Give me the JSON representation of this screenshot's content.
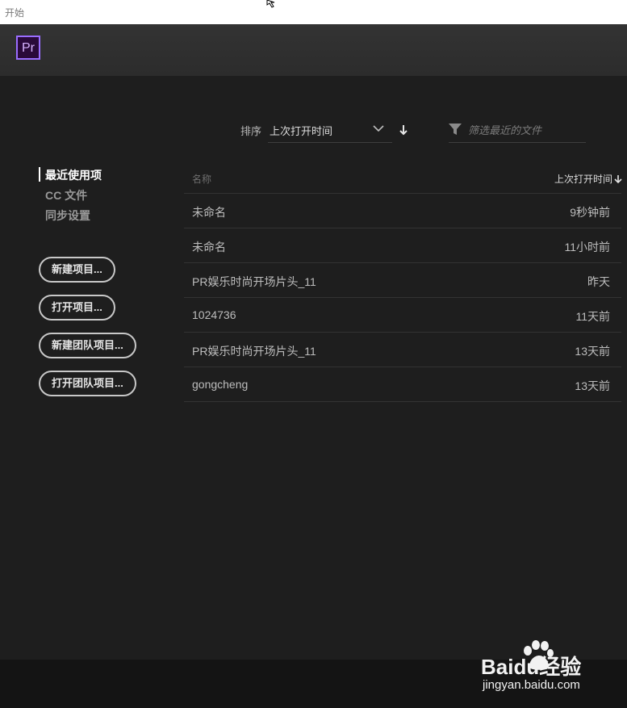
{
  "window": {
    "title": "开始"
  },
  "app": {
    "logo_text": "Pr",
    "accent": "#9a6dff"
  },
  "sort": {
    "label": "排序",
    "selected": "上次打开时间",
    "direction": "descending"
  },
  "filter": {
    "placeholder": "筛选最近的文件"
  },
  "nav": {
    "items": [
      {
        "label": "最近使用项",
        "active": true
      },
      {
        "label": "CC 文件",
        "active": false
      },
      {
        "label": "同步设置",
        "active": false
      }
    ]
  },
  "buttons": {
    "new_project": "新建项目...",
    "open_project": "打开项目...",
    "new_team_project": "新建团队项目...",
    "open_team_project": "打开团队项目..."
  },
  "table": {
    "col_name": "名称",
    "col_time": "上次打开时间",
    "rows": [
      {
        "name": "未命名",
        "time": "9秒钟前"
      },
      {
        "name": "未命名",
        "time": "11小时前"
      },
      {
        "name": "PR娱乐时尚开场片头_11",
        "time": "昨天"
      },
      {
        "name": "1024736",
        "time": "11天前"
      },
      {
        "name": "PR娱乐时尚开场片头_11",
        "time": "13天前"
      },
      {
        "name": "gongcheng",
        "time": "13天前"
      }
    ]
  },
  "watermark": {
    "brand": "Baidu经验",
    "site": "jingyan.baidu.com"
  }
}
